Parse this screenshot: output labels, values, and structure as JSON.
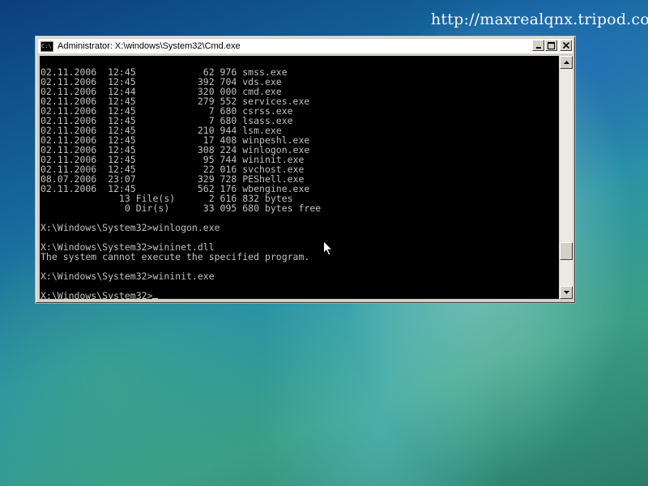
{
  "watermark": "http://maxrealqnx.tripod.com",
  "window": {
    "title": "Administrator: X:\\windows\\System32\\Cmd.exe",
    "icon_text": "C:\\",
    "buttons": {
      "minimize": "minimize-icon",
      "maximize": "maximize-icon",
      "close": "close-icon"
    }
  },
  "console": {
    "lines": [
      "02.11.2006  12:45            62 976 smss.exe",
      "02.11.2006  12:45           392 704 vds.exe",
      "02.11.2006  12:44           320 000 cmd.exe",
      "02.11.2006  12:45           279 552 services.exe",
      "02.11.2006  12:45             7 680 csrss.exe",
      "02.11.2006  12:45             7 680 lsass.exe",
      "02.11.2006  12:45           210 944 lsm.exe",
      "02.11.2006  12:45            17 408 winpeshl.exe",
      "02.11.2006  12:45           308 224 winlogon.exe",
      "02.11.2006  12:45            95 744 wininit.exe",
      "02.11.2006  12:45            22 016 svchost.exe",
      "08.07.2006  23:07           329 728 PEShell.exe",
      "02.11.2006  12:45           562 176 wbengine.exe",
      "              13 File(s)      2 616 832 bytes",
      "               0 Dir(s)      33 095 680 bytes free",
      "",
      "X:\\Windows\\System32>winlogon.exe",
      "",
      "X:\\Windows\\System32>wininet.dll",
      "The system cannot execute the specified program.",
      "",
      "X:\\Windows\\System32>wininit.exe",
      ""
    ],
    "prompt": "X:\\Windows\\System32>"
  },
  "scrollbar": {
    "position_fraction": 0.87
  },
  "colors": {
    "console_bg": "#000000",
    "console_text": "#c0c0c0",
    "chrome": "#d4d0c8"
  }
}
